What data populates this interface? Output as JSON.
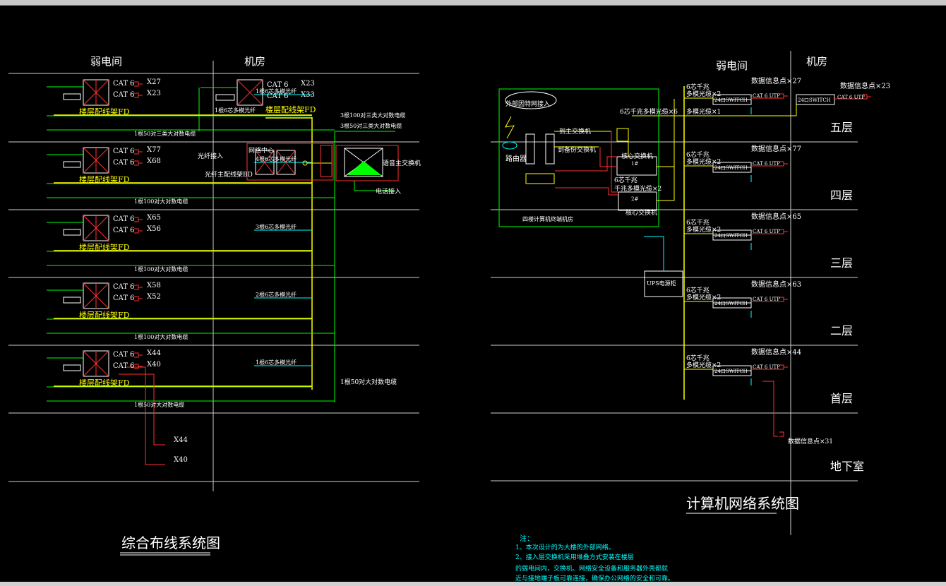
{
  "left": {
    "header_weak": "弱电间",
    "header_room": "机房",
    "title": "综合布线系统图",
    "floors": [
      {
        "cat_a": "CAT 6",
        "cat_b": "CAT 6",
        "count_a": "X27",
        "count_b": "X23",
        "fd": "楼层配线架FD",
        "fiber": "1根6芯多模光纤",
        "cable": "1根50对三类大对数电缆"
      },
      {
        "cat_a": "CAT 6",
        "cat_b": "CAT 6",
        "count_a": "X77",
        "count_b": "X68",
        "fd": "楼层配线架FD",
        "fiber": "4根6芯多模光纤",
        "cable": "1根100对大对数电缆"
      },
      {
        "cat_a": "CAT 6",
        "cat_b": "CAT 6",
        "count_a": "X65",
        "count_b": "X56",
        "fd": "楼层配线架FD",
        "fiber": "3根6芯多模光纤",
        "cable": "1根100对大对数电缆"
      },
      {
        "cat_a": "CAT 6",
        "cat_b": "CAT 6",
        "count_a": "X58",
        "count_b": "X52",
        "fd": "楼层配线架FD",
        "fiber": "2根6芯多模光纤",
        "cable": "1根100对大对数电缆"
      },
      {
        "cat_a": "CAT 6",
        "cat_b": "CAT 6",
        "count_a": "X44",
        "count_b": "X40",
        "fd": "楼层配线架FD",
        "fiber": "1根6芯多模光纤",
        "cable": "1根50对大对数电缆"
      }
    ],
    "room_rack": {
      "cat_a": "CAT 6",
      "cat_b": "CAT 6",
      "count_a": "X23",
      "count_b": "X33",
      "fd": "楼层配线架FD",
      "fiber": "1根6芯多模光纤"
    },
    "network_center": "网络中心",
    "fiber_in": "光纤接入",
    "fiber_main": "光纤主配线架BD",
    "voice_switch": "语音主交换机",
    "phone_in": "电话接入",
    "big_cable_1": "3根100对三类大对数电缆",
    "big_cable_2": "3根50对三类大对数电缆",
    "big_cable_3": "1根50对大对数电缆",
    "basement_out_a": "X44",
    "basement_out_b": "X40"
  },
  "right": {
    "header_weak": "弱电间",
    "header_room": "机房",
    "title": "计算机网络系统图",
    "external": "外部因特网接入",
    "router": "路由器",
    "to_main": "到主交换机",
    "to_backup": "到备份交换机",
    "core_switch": "核心交换机",
    "core_switch_b": "核心交换机",
    "fiber_6": "6芯千兆多模光缆×6",
    "fiber_2": "千兆多模光缆×2",
    "six_core": "6芯千兆",
    "ups": "UPS电源柜",
    "room_note": "四楼计算机终端机房",
    "floors": [
      {
        "name": "五层",
        "points": "数据信息点×27",
        "switch": "24口SWITCH",
        "multimode": "多模光缆×2",
        "multimode1": "多模光缆×1",
        "label": "6芯千兆"
      },
      {
        "name": "四层",
        "points": "数据信息点×77",
        "switch": "24口SWITCH",
        "multimode": "多模光缆×2",
        "label": "6芯千兆"
      },
      {
        "name": "三层",
        "points": "数据信息点×65",
        "switch": "24口SWITCH",
        "multimode": "多模光缆×2",
        "label": "6芯千兆"
      },
      {
        "name": "二层",
        "points": "数据信息点×63",
        "switch": "24口SWITCH",
        "multimode": "多模光缆×2",
        "label": "6芯千兆"
      },
      {
        "name": "首层",
        "points": "数据信息点×44",
        "switch": "24口SWITCH",
        "multimode": "多模光缆×2",
        "label": "6芯千兆"
      },
      {
        "name": "地下室",
        "points": "数据信息点×31",
        "switch": "",
        "multimode": "",
        "label": ""
      }
    ],
    "room_points": "数据信息点×23",
    "room_switch": "24口SWITCH",
    "sw_1": "1#",
    "sw_2": "2#",
    "cat": "CAT 6 UTP"
  },
  "notes": {
    "head": "注：",
    "l1": "1、本次设计的为大楼的外部网络。",
    "l2": "2、接入层交换机采用堆叠方式安装在楼层",
    "l3": "的弱电间内，交换机、网络安全设备和服务器外壳都就",
    "l4": "近与接地端子板可靠连接，确保办公网络的安全和可靠。"
  },
  "colors": {
    "grid": "#ffffff",
    "cable": "#00ff00",
    "yellow": "#ffff00",
    "red": "#ff2020",
    "cyan": "#00ffff",
    "text": "#ffffff"
  }
}
